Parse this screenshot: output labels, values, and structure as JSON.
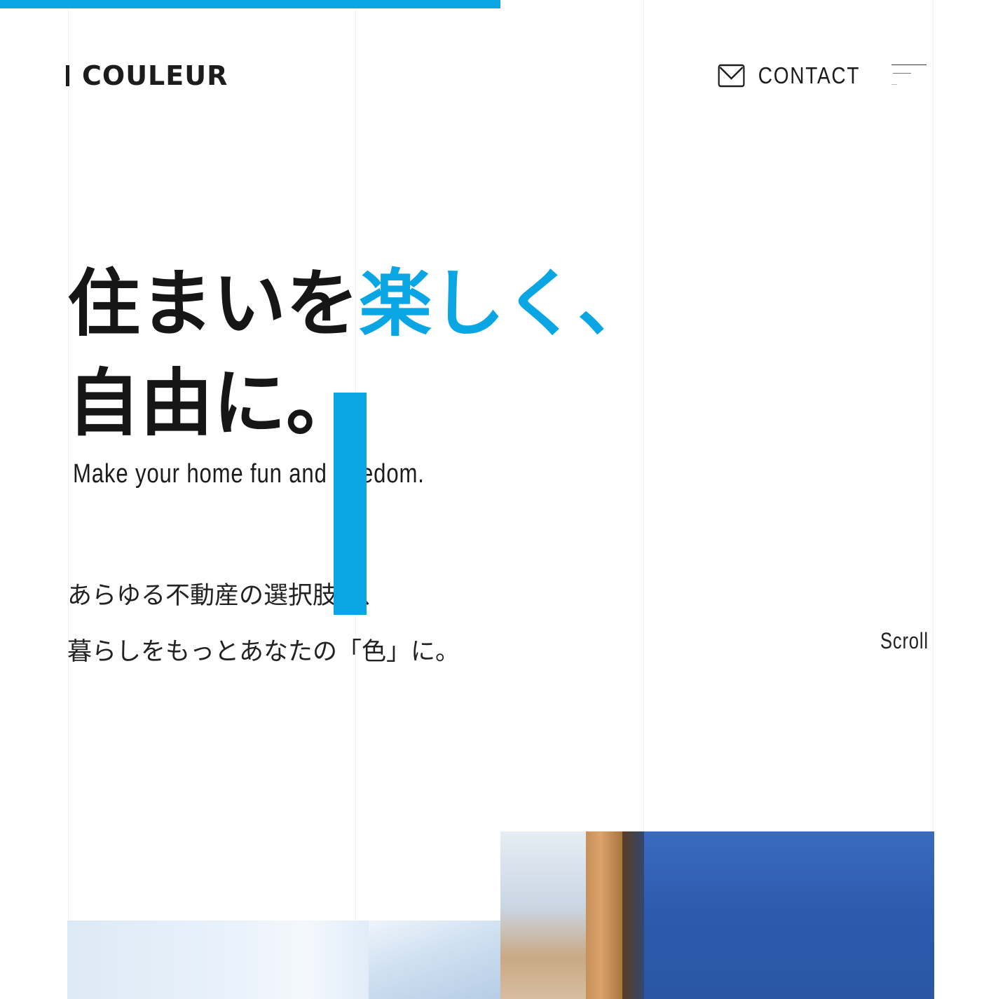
{
  "header": {
    "logo_text": "COULEUR",
    "contact_label": "CONTACT",
    "contact_icon": "mail-icon",
    "menu_icon": "hamburger-menu-icon"
  },
  "hero": {
    "headline_line1_dark": "住まいを",
    "headline_line1_accent": "楽しく、",
    "headline_line2": "自由に。",
    "subtitle": "Make your home fun and freedom.",
    "body_line1": "あらゆる不動産の選択肢で、",
    "body_line2": "暮らしをもっとあなたの「色」に。",
    "scroll_label": "Scroll"
  },
  "colors": {
    "accent": "#0aa6e4",
    "text": "#1c1c1c",
    "background": "#ffffff"
  }
}
